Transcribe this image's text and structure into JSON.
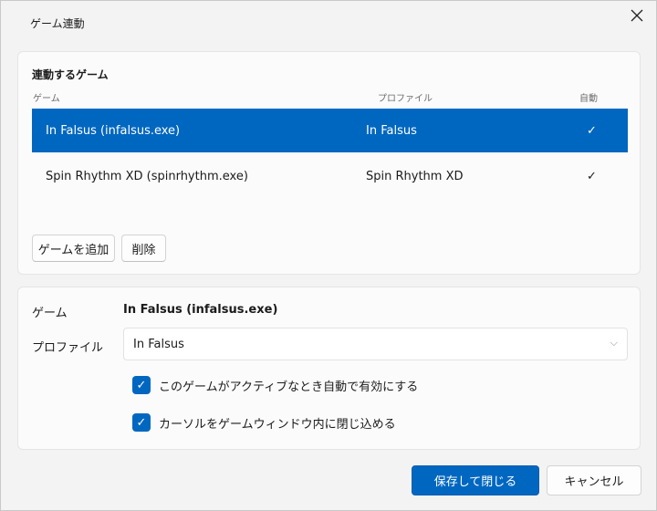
{
  "window": {
    "title": "ゲーム連動",
    "close_icon": "close-icon"
  },
  "games_section": {
    "title": "連動するゲーム",
    "columns": {
      "game": "ゲーム",
      "profile": "プロファイル",
      "auto": "自動"
    },
    "rows": [
      {
        "game": "In Falsus  (infalsus.exe)",
        "profile": "In Falsus",
        "auto": "✓",
        "selected": true
      },
      {
        "game": "Spin Rhythm XD  (spinrhythm.exe)",
        "profile": "Spin Rhythm XD",
        "auto": "✓",
        "selected": false
      }
    ],
    "add_button": "ゲームを追加",
    "delete_button": "削除"
  },
  "detail_section": {
    "game_label": "ゲーム",
    "game_value": "In Falsus  (infalsus.exe)",
    "profile_label": "プロファイル",
    "profile_value": "In Falsus",
    "auto_enable_label": "このゲームがアクティブなとき自動で有効にする",
    "auto_enable_checked": true,
    "confine_cursor_label": "カーソルをゲームウィンドウ内に閉じ込める",
    "confine_cursor_checked": true,
    "check_glyph": "✓",
    "dropdown_glyph": "⌵"
  },
  "footer": {
    "save_button": "保存して閉じる",
    "cancel_button": "キャンセル"
  },
  "colors": {
    "accent": "#0067c0",
    "background": "#f3f3f3",
    "card": "#fbfbfb"
  }
}
